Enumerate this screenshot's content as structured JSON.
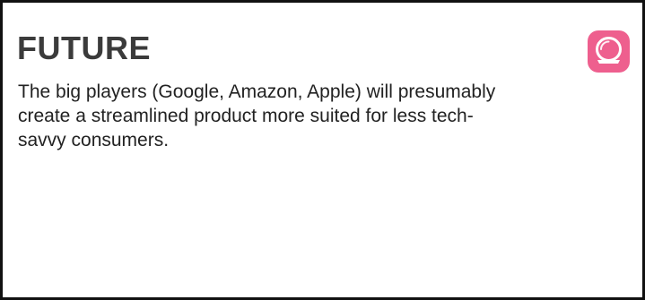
{
  "card": {
    "title": "FUTURE",
    "description": "The big players (Google, Amazon, Apple) will presumably create a streamlined product more suited for less tech-savvy consumers.",
    "badge_icon": "crystal-ball-icon",
    "badge_color": "#ee5f8e",
    "title_color": "#3b3b3b",
    "border_color": "#111111"
  }
}
